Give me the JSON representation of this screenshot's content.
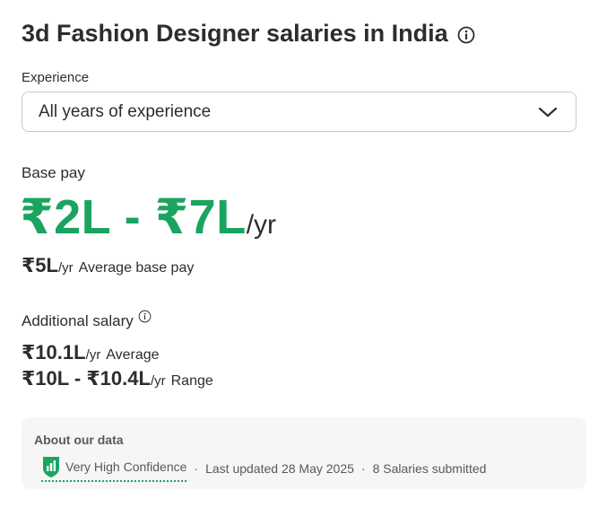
{
  "title": "3d Fashion Designer salaries in India",
  "experience": {
    "label": "Experience",
    "selected": "All years of experience"
  },
  "base_pay": {
    "label": "Base pay",
    "range": "₹2L - ₹7L",
    "range_unit": "/yr",
    "average_value": "₹5L",
    "average_unit": "/yr",
    "average_label": "Average base pay"
  },
  "additional_salary": {
    "label": "Additional salary",
    "average_value": "₹10.1L",
    "average_unit": "/yr",
    "average_label": "Average",
    "range_value": "₹10L - ₹10.4L",
    "range_unit": "/yr",
    "range_label": "Range"
  },
  "about_data": {
    "title": "About our data",
    "confidence": "Very High Confidence",
    "separator": "·",
    "last_updated": "Last updated 28 May 2025",
    "salaries_submitted": "8 Salaries submitted"
  },
  "colors": {
    "accent_green": "#1ba460",
    "text_dark": "#2d2d2d",
    "text_muted": "#595959",
    "panel_bg": "#f6f6f6"
  },
  "icons": {
    "title_info": "info-circle-icon",
    "dropdown": "chevron-down-icon",
    "additional_info": "info-circle-icon",
    "confidence": "shield-bar-chart-icon"
  }
}
